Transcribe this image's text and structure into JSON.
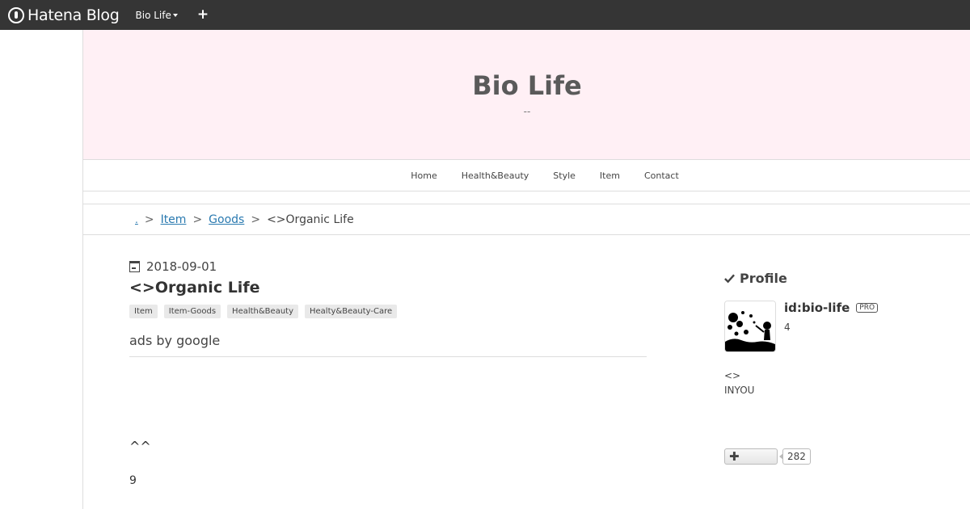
{
  "topbar": {
    "brand": "Hatena Blog",
    "blog_menu": "Bio Life",
    "add_label": "+"
  },
  "header": {
    "title": "Bio Life",
    "description": "--"
  },
  "nav": {
    "items": [
      "Home",
      "Health&Beauty",
      "Style",
      "Item",
      "Contact"
    ]
  },
  "breadcrumb": {
    "root": ".",
    "items": [
      "Item",
      "Goods"
    ],
    "current": "<>Organic Life",
    "separator": ">"
  },
  "article": {
    "date": "2018-09-01",
    "title": "<>Organic Life",
    "tags": [
      "Item",
      "Item-Goods",
      "Health&Beauty",
      "Healty&Beauty-Care"
    ],
    "ads_label": "ads by google",
    "body_line1": "^^",
    "body_line2": "9"
  },
  "sidebar": {
    "heading": "Profile",
    "profile_id": "id:bio-life",
    "pro_badge": "PRO",
    "profile_num": "4",
    "desc_line1": "<>",
    "desc_line2": "INYOU",
    "subscribe_count": "282"
  },
  "colors": {
    "topbar": "#353535",
    "header_bg": "#fff0f5",
    "link": "#2a7ab0"
  }
}
